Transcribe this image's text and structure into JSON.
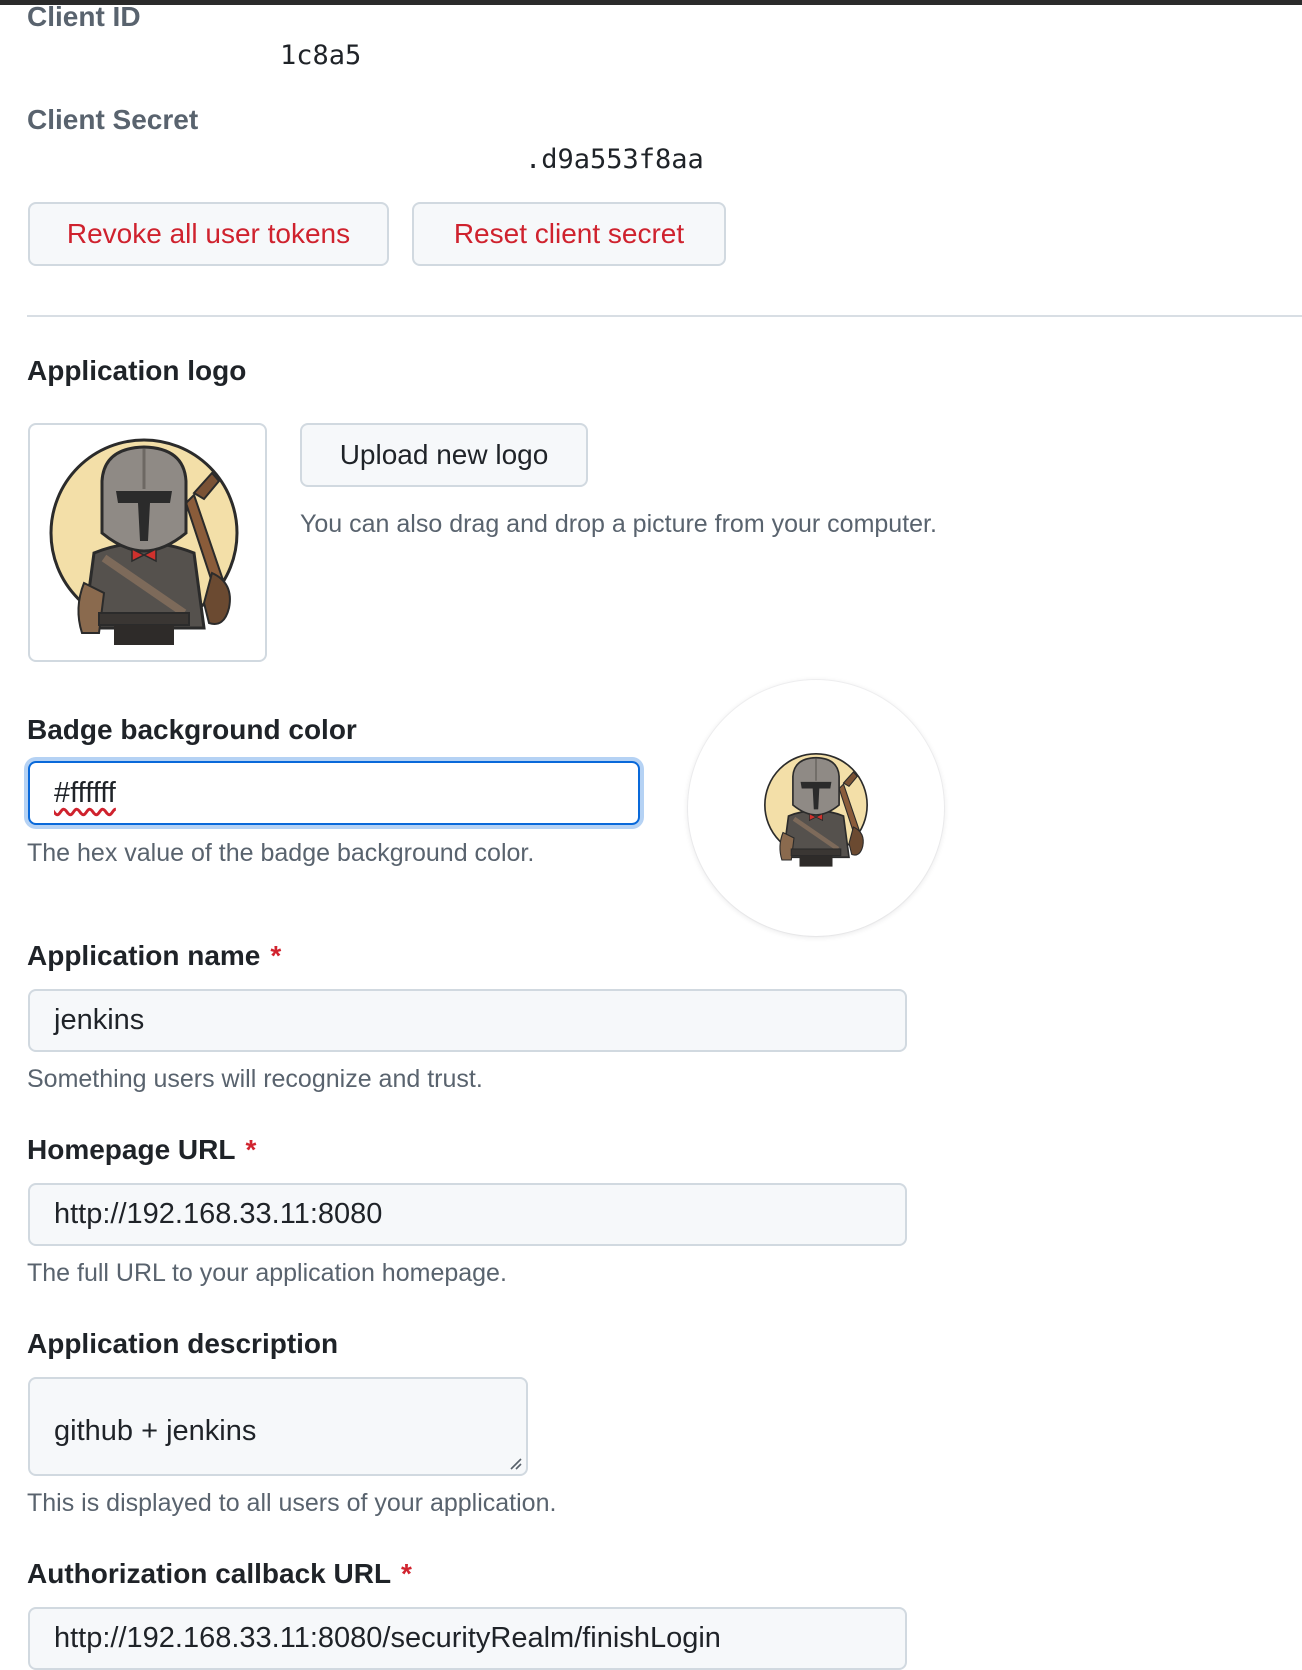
{
  "credentials": {
    "client_id_label": "Client ID",
    "client_id_value": "1c8a5",
    "client_secret_label": "Client Secret",
    "client_secret_value": ".d9a553f8aa",
    "revoke_button": "Revoke all user tokens",
    "reset_button": "Reset client secret"
  },
  "logo": {
    "label": "Application logo",
    "upload_button": "Upload new logo",
    "help": "You can also drag and drop a picture from your computer.",
    "icon": "mandalorian-avatar-icon"
  },
  "badge": {
    "label": "Badge background color",
    "value": "#ffffff",
    "help": "The hex value of the badge background color."
  },
  "form": {
    "required_marker": "*",
    "app_name": {
      "label": "Application name",
      "value": "jenkins",
      "help": "Something users will recognize and trust."
    },
    "homepage": {
      "label": "Homepage URL",
      "value": "http://192.168.33.11:8080",
      "help": "The full URL to your application homepage."
    },
    "description": {
      "label": "Application description",
      "value": "github + jenkins",
      "help": "This is displayed to all users of your application."
    },
    "callback": {
      "label": "Authorization callback URL",
      "value": "http://192.168.33.11:8080/securityRealm/finishLogin"
    }
  },
  "colors": {
    "danger": "#cf222e",
    "focus": "#0969da",
    "muted": "#59636e"
  }
}
